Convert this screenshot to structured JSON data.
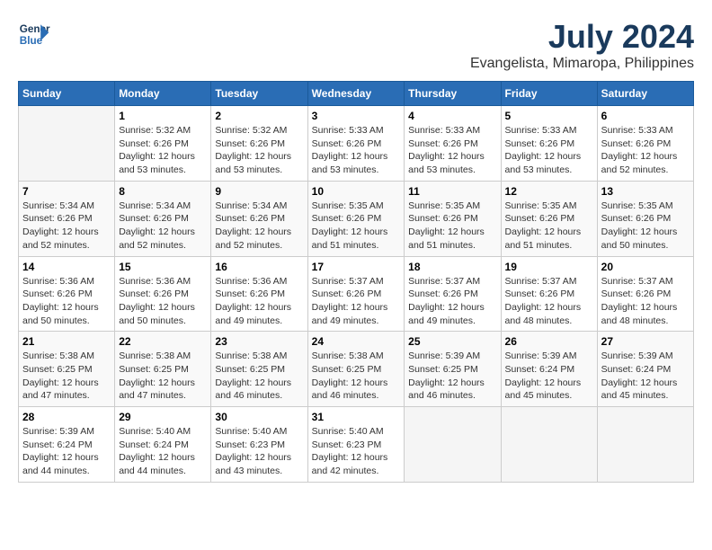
{
  "header": {
    "logo_line1": "General",
    "logo_line2": "Blue",
    "month_year": "July 2024",
    "location": "Evangelista, Mimaropa, Philippines"
  },
  "days_of_week": [
    "Sunday",
    "Monday",
    "Tuesday",
    "Wednesday",
    "Thursday",
    "Friday",
    "Saturday"
  ],
  "weeks": [
    [
      {
        "day": "",
        "info": ""
      },
      {
        "day": "1",
        "info": "Sunrise: 5:32 AM\nSunset: 6:26 PM\nDaylight: 12 hours\nand 53 minutes."
      },
      {
        "day": "2",
        "info": "Sunrise: 5:32 AM\nSunset: 6:26 PM\nDaylight: 12 hours\nand 53 minutes."
      },
      {
        "day": "3",
        "info": "Sunrise: 5:33 AM\nSunset: 6:26 PM\nDaylight: 12 hours\nand 53 minutes."
      },
      {
        "day": "4",
        "info": "Sunrise: 5:33 AM\nSunset: 6:26 PM\nDaylight: 12 hours\nand 53 minutes."
      },
      {
        "day": "5",
        "info": "Sunrise: 5:33 AM\nSunset: 6:26 PM\nDaylight: 12 hours\nand 53 minutes."
      },
      {
        "day": "6",
        "info": "Sunrise: 5:33 AM\nSunset: 6:26 PM\nDaylight: 12 hours\nand 52 minutes."
      }
    ],
    [
      {
        "day": "7",
        "info": "Sunrise: 5:34 AM\nSunset: 6:26 PM\nDaylight: 12 hours\nand 52 minutes."
      },
      {
        "day": "8",
        "info": "Sunrise: 5:34 AM\nSunset: 6:26 PM\nDaylight: 12 hours\nand 52 minutes."
      },
      {
        "day": "9",
        "info": "Sunrise: 5:34 AM\nSunset: 6:26 PM\nDaylight: 12 hours\nand 52 minutes."
      },
      {
        "day": "10",
        "info": "Sunrise: 5:35 AM\nSunset: 6:26 PM\nDaylight: 12 hours\nand 51 minutes."
      },
      {
        "day": "11",
        "info": "Sunrise: 5:35 AM\nSunset: 6:26 PM\nDaylight: 12 hours\nand 51 minutes."
      },
      {
        "day": "12",
        "info": "Sunrise: 5:35 AM\nSunset: 6:26 PM\nDaylight: 12 hours\nand 51 minutes."
      },
      {
        "day": "13",
        "info": "Sunrise: 5:35 AM\nSunset: 6:26 PM\nDaylight: 12 hours\nand 50 minutes."
      }
    ],
    [
      {
        "day": "14",
        "info": "Sunrise: 5:36 AM\nSunset: 6:26 PM\nDaylight: 12 hours\nand 50 minutes."
      },
      {
        "day": "15",
        "info": "Sunrise: 5:36 AM\nSunset: 6:26 PM\nDaylight: 12 hours\nand 50 minutes."
      },
      {
        "day": "16",
        "info": "Sunrise: 5:36 AM\nSunset: 6:26 PM\nDaylight: 12 hours\nand 49 minutes."
      },
      {
        "day": "17",
        "info": "Sunrise: 5:37 AM\nSunset: 6:26 PM\nDaylight: 12 hours\nand 49 minutes."
      },
      {
        "day": "18",
        "info": "Sunrise: 5:37 AM\nSunset: 6:26 PM\nDaylight: 12 hours\nand 49 minutes."
      },
      {
        "day": "19",
        "info": "Sunrise: 5:37 AM\nSunset: 6:26 PM\nDaylight: 12 hours\nand 48 minutes."
      },
      {
        "day": "20",
        "info": "Sunrise: 5:37 AM\nSunset: 6:26 PM\nDaylight: 12 hours\nand 48 minutes."
      }
    ],
    [
      {
        "day": "21",
        "info": "Sunrise: 5:38 AM\nSunset: 6:25 PM\nDaylight: 12 hours\nand 47 minutes."
      },
      {
        "day": "22",
        "info": "Sunrise: 5:38 AM\nSunset: 6:25 PM\nDaylight: 12 hours\nand 47 minutes."
      },
      {
        "day": "23",
        "info": "Sunrise: 5:38 AM\nSunset: 6:25 PM\nDaylight: 12 hours\nand 46 minutes."
      },
      {
        "day": "24",
        "info": "Sunrise: 5:38 AM\nSunset: 6:25 PM\nDaylight: 12 hours\nand 46 minutes."
      },
      {
        "day": "25",
        "info": "Sunrise: 5:39 AM\nSunset: 6:25 PM\nDaylight: 12 hours\nand 46 minutes."
      },
      {
        "day": "26",
        "info": "Sunrise: 5:39 AM\nSunset: 6:24 PM\nDaylight: 12 hours\nand 45 minutes."
      },
      {
        "day": "27",
        "info": "Sunrise: 5:39 AM\nSunset: 6:24 PM\nDaylight: 12 hours\nand 45 minutes."
      }
    ],
    [
      {
        "day": "28",
        "info": "Sunrise: 5:39 AM\nSunset: 6:24 PM\nDaylight: 12 hours\nand 44 minutes."
      },
      {
        "day": "29",
        "info": "Sunrise: 5:40 AM\nSunset: 6:24 PM\nDaylight: 12 hours\nand 44 minutes."
      },
      {
        "day": "30",
        "info": "Sunrise: 5:40 AM\nSunset: 6:23 PM\nDaylight: 12 hours\nand 43 minutes."
      },
      {
        "day": "31",
        "info": "Sunrise: 5:40 AM\nSunset: 6:23 PM\nDaylight: 12 hours\nand 42 minutes."
      },
      {
        "day": "",
        "info": ""
      },
      {
        "day": "",
        "info": ""
      },
      {
        "day": "",
        "info": ""
      }
    ]
  ]
}
